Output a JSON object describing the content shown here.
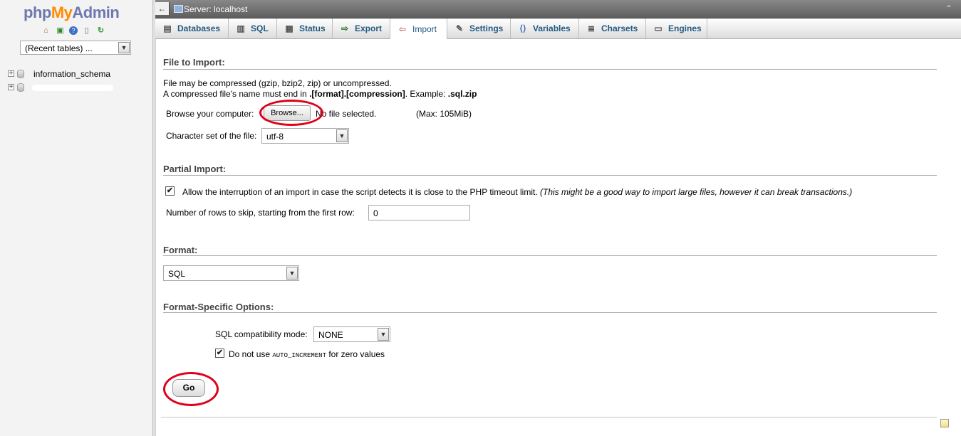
{
  "logo": {
    "php": "php",
    "my": "My",
    "admin": "Admin"
  },
  "nav": {
    "icons": [
      "home-icon",
      "exit-icon",
      "help-icon",
      "docs-icon",
      "reload-icon"
    ],
    "recent_tables": "(Recent tables) ...",
    "databases": [
      "information_schema"
    ]
  },
  "topbar": {
    "back": "←",
    "server": "Server: localhost",
    "collapse": "⌃"
  },
  "tabs": [
    {
      "label": "Databases",
      "icon": "databases-icon"
    },
    {
      "label": "SQL",
      "icon": "sql-icon"
    },
    {
      "label": "Status",
      "icon": "status-icon"
    },
    {
      "label": "Export",
      "icon": "export-icon"
    },
    {
      "label": "Import",
      "icon": "import-icon",
      "active": true
    },
    {
      "label": "Settings",
      "icon": "settings-icon"
    },
    {
      "label": "Variables",
      "icon": "variables-icon"
    },
    {
      "label": "Charsets",
      "icon": "charsets-icon"
    },
    {
      "label": "Engines",
      "icon": "engines-icon"
    }
  ],
  "file_import": {
    "title": "File to Import:",
    "line1": "File may be compressed (gzip, bzip2, zip) or uncompressed.",
    "line2_prefix": "A compressed file's name must end in ",
    "line2_bold": ".[format].[compression]",
    "line2_mid": ". Example: ",
    "line2_example": ".sql.zip",
    "browse_label": "Browse your computer:",
    "browse_button": "Browse...",
    "no_file": "No file selected.",
    "max": "(Max: 105MiB)",
    "charset_label": "Character set of the file:",
    "charset_value": "utf-8"
  },
  "partial_import": {
    "title": "Partial Import:",
    "allow_interrupt": "Allow the interruption of an import in case the script detects it is close to the PHP timeout limit.",
    "allow_interrupt_note": "(This might be a good way to import large files, however it can break transactions.)",
    "allow_interrupt_checked": true,
    "skip_label": "Number of rows to skip, starting from the first row:",
    "skip_value": "0"
  },
  "format": {
    "title": "Format:",
    "value": "SQL"
  },
  "format_options": {
    "title": "Format-Specific Options:",
    "compat_label": "SQL compatibility mode:",
    "compat_value": "NONE",
    "no_auto_prefix": "Do not use ",
    "no_auto_code": "AUTO_INCREMENT",
    "no_auto_suffix": " for zero values",
    "no_auto_checked": true
  },
  "go_button": "Go",
  "colors": {
    "highlight_oval": "#e0001b",
    "tab_text": "#235a81",
    "logo_orange": "#ff8c00",
    "logo_blue": "#6c78af"
  }
}
